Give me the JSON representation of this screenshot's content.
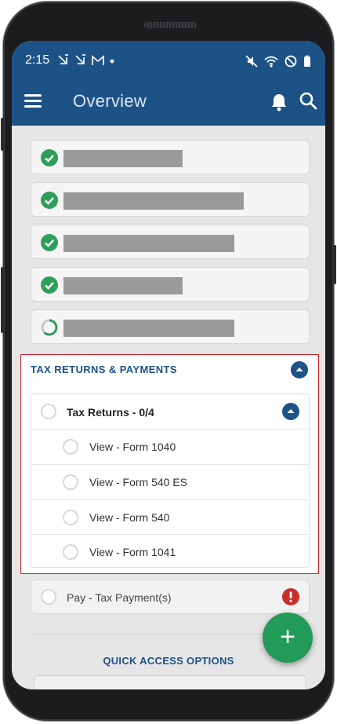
{
  "status_bar": {
    "time": "2:15",
    "notification_icons": [
      "missed-call-icon",
      "missed-call-icon",
      "gmail-icon",
      "dot-icon"
    ],
    "system_icons": [
      "mute-icon",
      "wifi-icon",
      "do-not-disturb-icon",
      "battery-icon"
    ]
  },
  "toolbar": {
    "title": "Overview",
    "menu_icon": "hamburger-menu-icon",
    "actions": [
      "bell-icon",
      "search-icon"
    ]
  },
  "checklist": {
    "items": [
      {
        "status": "complete",
        "label": ""
      },
      {
        "status": "complete",
        "label": ""
      },
      {
        "status": "complete",
        "label": ""
      },
      {
        "status": "complete",
        "label": ""
      },
      {
        "status": "in-progress",
        "label": ""
      }
    ]
  },
  "tax_section": {
    "title": "TAX RETURNS & PAYMENTS",
    "group": {
      "label": "Tax Returns - 0/4",
      "items": [
        {
          "label": "View - Form 1040"
        },
        {
          "label": "View - Form 540 ES"
        },
        {
          "label": "View - Form 540"
        },
        {
          "label": "View - Form 1041"
        }
      ]
    }
  },
  "payment": {
    "label": "Pay - Tax Payment(s)",
    "alert_icon": "exclamation-icon"
  },
  "quick_access": {
    "label": "QUICK ACCESS OPTIONS"
  },
  "fab": {
    "symbol": "+"
  },
  "colors": {
    "primary": "#1d5287",
    "success": "#2e9e5b",
    "danger": "#d0232a",
    "fab": "#239b58"
  }
}
